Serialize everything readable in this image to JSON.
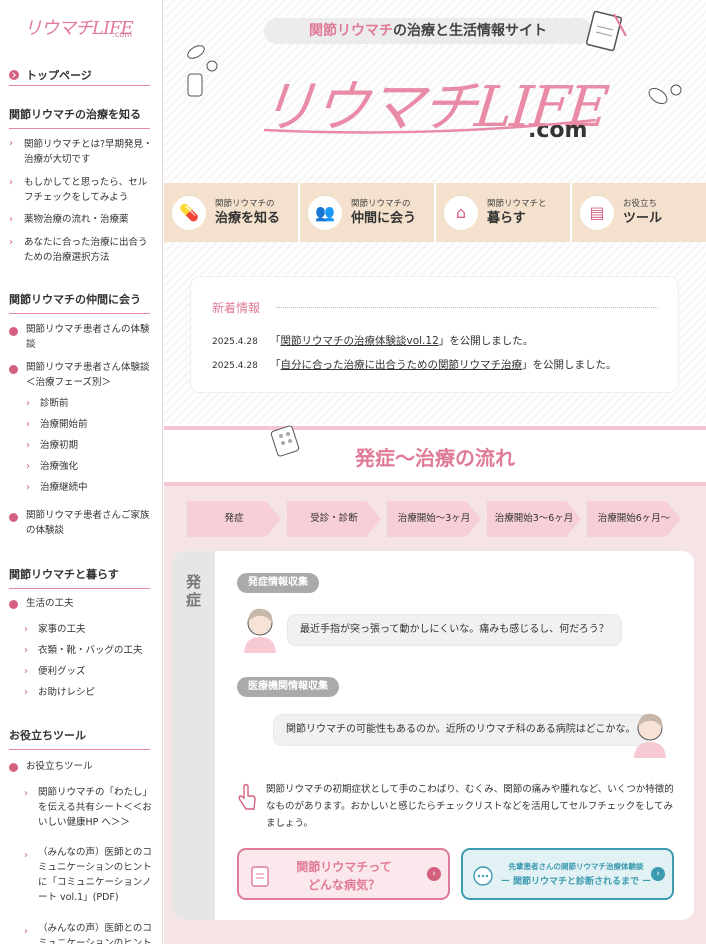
{
  "site": {
    "logo_small": "リウマチLIFE",
    "logo_small_suffix": ".com",
    "tagline_accent": "関節リウマチ",
    "tagline_rest": "の治療と生活情報サイト",
    "logo_big": "リウマチLIFE",
    "logo_big_suffix": ".com"
  },
  "sidebar": {
    "top": "トップページ",
    "sec1": {
      "title": "関節リウマチの治療を知る",
      "items": [
        "関節リウマチとは?早期発見・治療が大切です",
        "もしかしてと思ったら、セルフチェックをしてみよう",
        "薬物治療の流れ・治療薬",
        "あなたに合った治療に出合うための治療選択方法"
      ]
    },
    "sec2": {
      "title": "関節リウマチの仲間に会う",
      "items": [
        "関節リウマチ患者さんの体験談",
        "関節リウマチ患者さん体験談＜治療フェーズ別＞"
      ],
      "sub": [
        "診断前",
        "治療開始前",
        "治療初期",
        "治療強化",
        "治療継続中"
      ],
      "last": "関節リウマチ患者さんご家族の体験談"
    },
    "sec3": {
      "title": "関節リウマチと暮らす",
      "item": "生活の工夫",
      "sub": [
        "家事の工夫",
        "衣類・靴・バッグの工夫",
        "便利グッズ",
        "お助けレシピ"
      ]
    },
    "sec4": {
      "title": "お役立ちツール",
      "item": "お役立ちツール",
      "sub": [
        "関節リウマチの「わたし」を伝える共有シート＜＜おいしい健康HP へ＞＞",
        "（みんなの声）医師とのコミュニケーションのヒントに「コミュニケーションノート vol.1」(PDF)",
        "（みんなの声）医師とのコミュニケーションのヒント"
      ]
    }
  },
  "nav": [
    {
      "sub": "関節リウマチの",
      "main": "治療を知る",
      "icon": "medicine-icon"
    },
    {
      "sub": "関節リウマチの",
      "main": "仲間に会う",
      "icon": "people-icon"
    },
    {
      "sub": "関節リウマチと",
      "main": "暮らす",
      "icon": "house-icon"
    },
    {
      "sub": "お役立ち",
      "main": "ツール",
      "icon": "document-icon"
    }
  ],
  "news": {
    "heading": "新着情報",
    "items": [
      {
        "date": "2025.4.28",
        "pre": "「",
        "link": "関節リウマチの治療体験談vol.12",
        "post": "」を公開しました。"
      },
      {
        "date": "2025.4.28",
        "pre": "「",
        "link": "自分に合った治療に出合うための関節リウマチ治療",
        "post": "」を公開しました。"
      }
    ]
  },
  "flow": {
    "heading": "発症〜治療の流れ",
    "steps": [
      "発症",
      "受診・診断",
      "治療開始〜3ヶ月",
      "治療開始3〜6ヶ月",
      "治療開始6ヶ月〜"
    ],
    "phase_label": "発症",
    "pill1": "発症情報収集",
    "bubble1": "最近手指が突っ張って動かしにくいな。痛みも感じるし、何だろう？",
    "pill2": "医療機関情報収集",
    "bubble2": "関節リウマチの可能性もあるのか。近所のリウマチ科のある病院はどこかな。",
    "note": "関節リウマチの初期症状として手のこわばり、むくみ、関節の痛みや腫れなど、いくつか特徴的なものがあります。おかしいと感じたらチェックリストなどを活用してセルフチェックをしてみましょう。",
    "btn1_line1": "関節リウマチって",
    "btn1_line2": "どんな病気？",
    "btn2_line1": "先輩患者さんの関節リウマチ治療体験談",
    "btn2_line2": "ー 関節リウマチと診断されるまで ー"
  }
}
